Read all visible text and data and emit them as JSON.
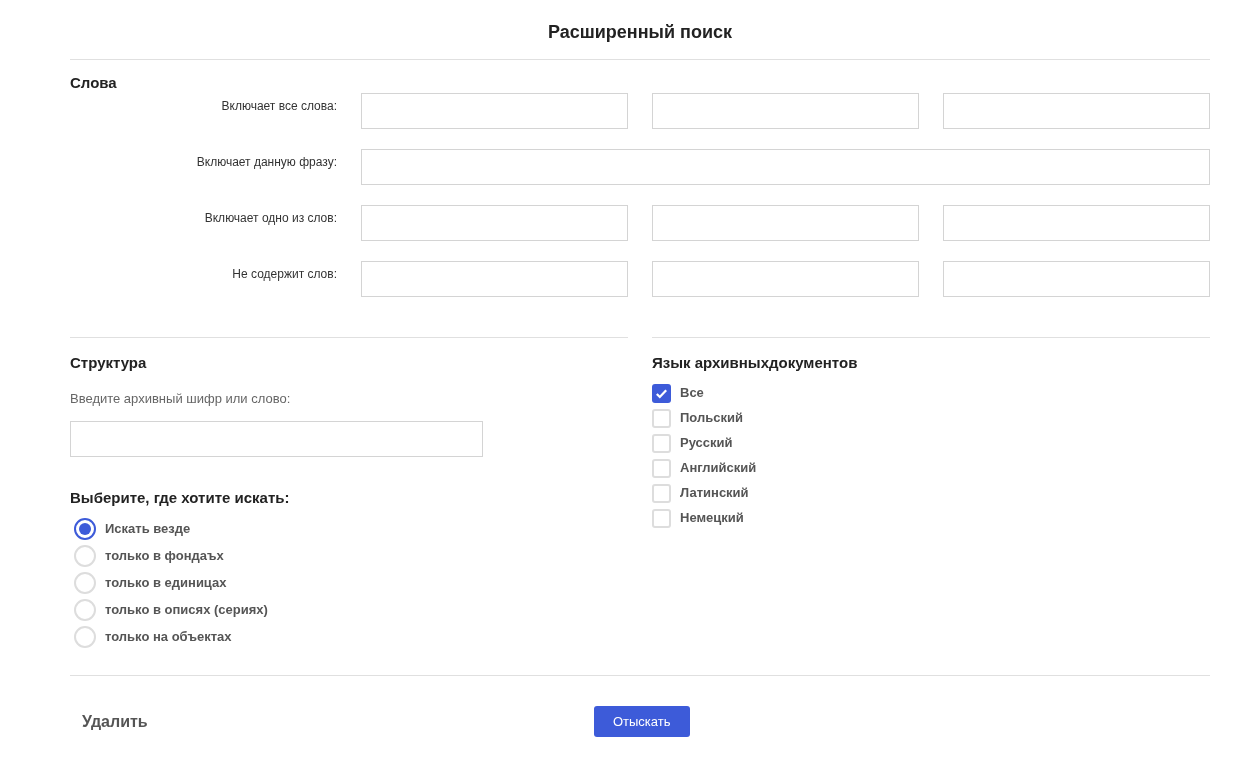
{
  "title": "Расширенный поиск",
  "words": {
    "heading": "Слова",
    "rows": [
      {
        "label": "Включает все слова:",
        "kind": "triple"
      },
      {
        "label": "Включает данную фразу:",
        "kind": "single"
      },
      {
        "label": "Включает одно из слов:",
        "kind": "triple"
      },
      {
        "label": "Не содержит слов:",
        "kind": "triple"
      }
    ]
  },
  "structure": {
    "heading": "Структура",
    "prompt": "Введите архивный шифр или слово:"
  },
  "scope": {
    "heading": "Выберите, где хотите искать:",
    "options": [
      {
        "label": "Искать везде",
        "selected": true
      },
      {
        "label": "только в фондаъх",
        "selected": false
      },
      {
        "label": "только в единицах",
        "selected": false
      },
      {
        "label": "только в описях (сериях)",
        "selected": false
      },
      {
        "label": "только на объектах",
        "selected": false
      }
    ]
  },
  "languages": {
    "heading": "Язык архивныхдокументов",
    "options": [
      {
        "label": "Все",
        "checked": true
      },
      {
        "label": "Польский",
        "checked": false
      },
      {
        "label": "Русский",
        "checked": false
      },
      {
        "label": "Английский",
        "checked": false
      },
      {
        "label": "Латинский",
        "checked": false
      },
      {
        "label": "Немецкий",
        "checked": false
      }
    ]
  },
  "buttons": {
    "clear": "Удалить",
    "search": "Отыскать"
  }
}
